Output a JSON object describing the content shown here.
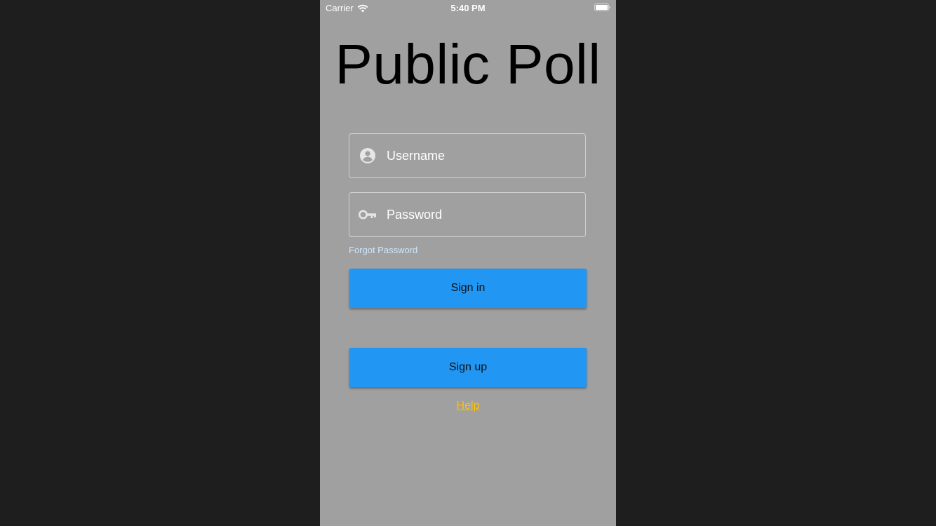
{
  "status_bar": {
    "carrier": "Carrier",
    "time": "5:40 PM"
  },
  "app": {
    "title": "Public Poll"
  },
  "login_form": {
    "username_placeholder": "Username",
    "password_placeholder": "Password",
    "forgot_password": "Forgot Password",
    "sign_in_label": "Sign in",
    "sign_up_label": "Sign up",
    "help_label": "Help"
  },
  "icons": {
    "username": "account-circle-icon",
    "password": "key-icon",
    "wifi": "wifi-icon",
    "battery": "battery-icon"
  },
  "colors": {
    "background": "#a0a0a0",
    "outer_background": "#1e1e1e",
    "button": "#2196f3",
    "help_link": "#ffc107",
    "forgot_link": "#cfe6ff"
  }
}
